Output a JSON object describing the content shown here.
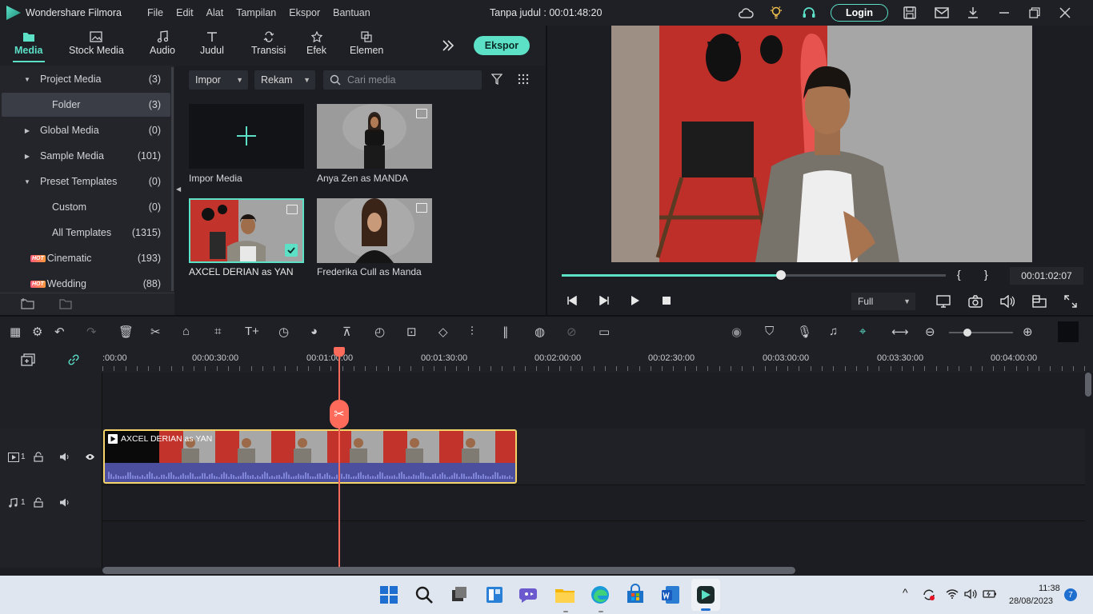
{
  "titlebar": {
    "app_name": "Wondershare Filmora",
    "menu": [
      "File",
      "Edit",
      "Alat",
      "Tampilan",
      "Ekspor",
      "Bantuan"
    ],
    "document_title": "Tanpa judul : 00:01:48:20",
    "login_label": "Login"
  },
  "nav_tabs": [
    {
      "label": "Media",
      "icon": "folder-icon"
    },
    {
      "label": "Stock Media",
      "icon": "image-icon"
    },
    {
      "label": "Audio",
      "icon": "music-icon"
    },
    {
      "label": "Judul",
      "icon": "title-icon"
    },
    {
      "label": "Transisi",
      "icon": "transition-icon"
    },
    {
      "label": "Efek",
      "icon": "effect-icon"
    },
    {
      "label": "Elemen",
      "icon": "element-icon"
    }
  ],
  "export_label": "Ekspor",
  "tree": [
    {
      "label": "Project Media",
      "count": "(3)",
      "arrow": "down"
    },
    {
      "label": "Folder",
      "count": "(3)",
      "selected": true
    },
    {
      "label": "Global Media",
      "count": "(0)",
      "arrow": "right"
    },
    {
      "label": "Sample Media",
      "count": "(101)",
      "arrow": "right"
    },
    {
      "label": "Preset Templates",
      "count": "(0)",
      "arrow": "down"
    },
    {
      "label": "Custom",
      "count": "(0)"
    },
    {
      "label": "All Templates",
      "count": "(1315)"
    },
    {
      "label": "Cinematic",
      "count": "(193)",
      "hot": "HOT"
    },
    {
      "label": "Wedding",
      "count": "(88)",
      "hot": "HOT"
    }
  ],
  "media_toolbar": {
    "import_label": "Impor",
    "record_label": "Rekam",
    "search_placeholder": "Cari media"
  },
  "media_items": [
    {
      "label": "Impor Media"
    },
    {
      "label": "Anya Zen as MANDA"
    },
    {
      "label": "AXCEL DERIAN as YAN",
      "selected": true
    },
    {
      "label": "Frederika Cull as Manda"
    }
  ],
  "preview": {
    "progress": 0.57,
    "timecode": "00:01:02:07",
    "quality": "Full",
    "bracket_in": "{",
    "bracket_out": "}"
  },
  "ruler": {
    "labels": [
      ":00:00",
      "00:00:30:00",
      "00:01:00:00",
      "00:01:30:00",
      "00:02:00:00",
      "00:02:30:00",
      "00:03:00:00",
      "00:03:30:00",
      "00:04:00:00"
    ]
  },
  "tracks": {
    "video_track_num": "1",
    "audio_track_num": "1",
    "clip_title": "AXCEL DERIAN as YAN"
  },
  "taskbar": {
    "time": "11:38",
    "date": "28/08/2023",
    "notif_count": "7"
  },
  "colors": {
    "accent": "#5ce0c6",
    "playhead": "#ff6b5a",
    "clip_border": "#f4d468"
  }
}
